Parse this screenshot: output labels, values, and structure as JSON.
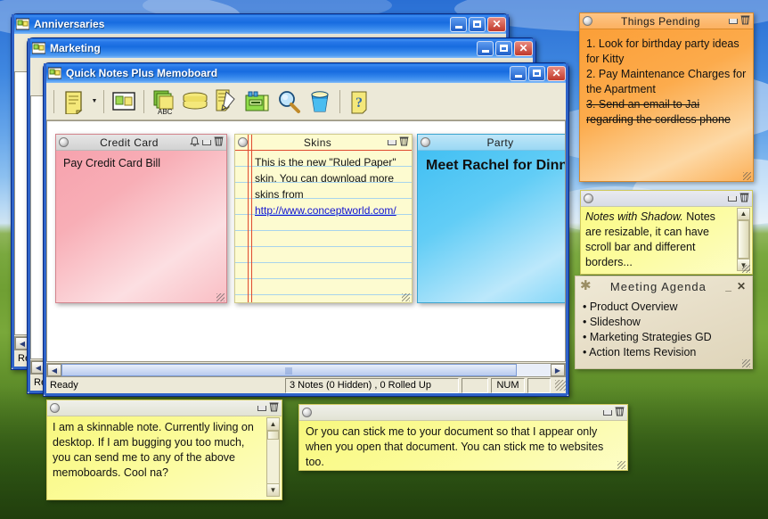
{
  "desktop": {
    "wallpaper": "bliss-green-hills"
  },
  "windows": [
    {
      "title": "Anniversaries",
      "icon": "memoboard-icon",
      "status": "Re"
    },
    {
      "title": "Marketing",
      "icon": "memoboard-icon",
      "status": "Re"
    },
    {
      "title": "Quick Notes Plus Memoboard",
      "icon": "memoboard-icon",
      "status": "Rea"
    }
  ],
  "window_buttons": {
    "minimize": "_",
    "maximize": "□",
    "close": "✕"
  },
  "toolbar": {
    "tools": [
      {
        "name": "new-note-icon",
        "tip": "New Note"
      },
      {
        "name": "new-note-dropdown-arrow-icon",
        "tip": "New Note Options"
      },
      {
        "name": "memoboard-icon",
        "tip": "Memoboard"
      },
      {
        "name": "notes-abc-icon",
        "tip": "Notes ABC"
      },
      {
        "name": "rolled-notes-stack-icon",
        "tip": "Rolled Up Notes"
      },
      {
        "name": "edit-note-icon",
        "tip": "Edit Note"
      },
      {
        "name": "note-tools-icon",
        "tip": "Note Tools"
      },
      {
        "name": "search-icon",
        "tip": "Search Notes"
      },
      {
        "name": "recycle-bin-icon",
        "tip": "Recycle Bin"
      },
      {
        "name": "help-icon",
        "tip": "Help"
      }
    ]
  },
  "statusbar": {
    "ready": "Ready",
    "notes_count": "3 Notes (0 Hidden)  , 0 Rolled Up",
    "blank": "",
    "num": "NUM"
  },
  "notes": {
    "credit_card": {
      "title": "Credit Card",
      "body": "Pay Credit Card Bill",
      "color": "#f6a8b0",
      "has_alarm": true
    },
    "skins": {
      "title": "Skins",
      "body_line1": "This is the new \"Ruled Paper\"",
      "body_line2": "skin. You can download more",
      "body_line3": "skins from",
      "link": "http://www.conceptworld.com/",
      "color": "#fdfbd0"
    },
    "party": {
      "title": "Party",
      "body": "Meet Rachel for Dinner",
      "color": "#4fc3f4"
    },
    "things_pending": {
      "title": "Things Pending",
      "item1": "1. Look for birthday party ideas for Kitty",
      "item2": "2. Pay Maintenance Charges for the Apartment",
      "item3": "3. Send an email to Jai regarding the cordless phone",
      "item3_struck": true,
      "color": "#fca342"
    },
    "shadow": {
      "title": "",
      "emphasis": "Notes with Shadow.",
      "body": " Notes are resizable, it can have scroll bar and different borders...",
      "color": "#fbfb8f"
    },
    "meeting_agenda": {
      "title": "Meeting Agenda",
      "icon": "asterisk-icon",
      "minimize": "_",
      "close": "✕",
      "items": [
        "• Product Overview",
        "• Slideshow",
        "• Marketing Strategies GD",
        "• Action Items Revision"
      ],
      "color": "#e8e2cf"
    },
    "skinnable": {
      "title": "",
      "body": "I am a skinnable note. Currently living on desktop. If I am bugging you too much, you can send me to any of the above memoboards. Cool na?",
      "color": "#fbfb8f"
    },
    "stick_doc": {
      "title": "",
      "body": "Or you can stick me to your document so that I appear only when you open that document. You can stick me to websites too.",
      "color": "#fbfb8f"
    }
  }
}
